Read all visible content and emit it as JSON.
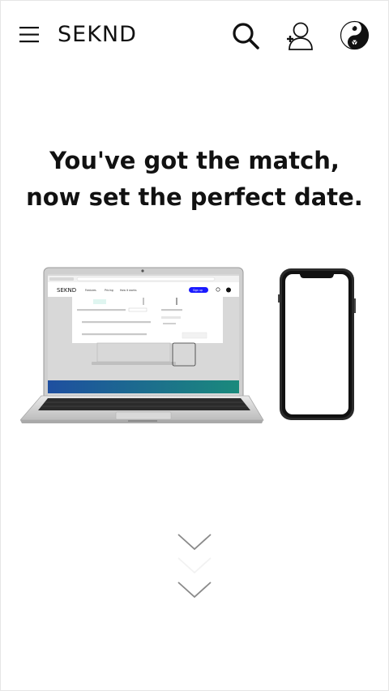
{
  "header": {
    "brand": "SEKND",
    "icons": {
      "menu": "hamburger-menu-icon",
      "search": "search-icon",
      "account": "add-user-icon",
      "avatar": "yin-yang-avatar-icon"
    }
  },
  "hero": {
    "line1": "You've got the match,",
    "line2": "now set the perfect date."
  },
  "illustration": {
    "laptop_screen": {
      "brand": "SEKND",
      "nav": [
        "Features",
        "Pricing",
        "How it works"
      ],
      "cta": "Sign up"
    }
  },
  "scroll_hint": {
    "icon": "chevron-down-icon"
  },
  "colors": {
    "text": "#111111",
    "laptop_body": "#d4d4d4",
    "cta_blue": "#1a1aff",
    "gradient_start": "#1e4fa0",
    "gradient_end": "#1a8a7c"
  }
}
